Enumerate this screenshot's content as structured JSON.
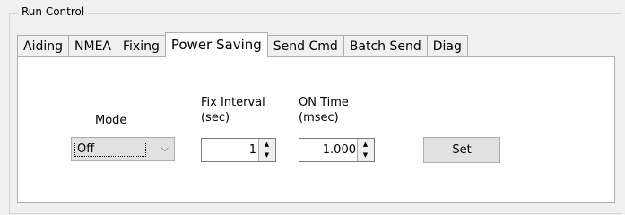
{
  "group": {
    "title": "Run Control"
  },
  "tabs": [
    {
      "label": "Aiding"
    },
    {
      "label": "NMEA"
    },
    {
      "label": "Fixing"
    },
    {
      "label": "Power Saving",
      "active": true
    },
    {
      "label": "Send Cmd"
    },
    {
      "label": "Batch Send"
    },
    {
      "label": "Diag"
    }
  ],
  "power_saving": {
    "mode_label": "Mode",
    "mode_value": "Off",
    "fix_interval_label_line1": "Fix Interval",
    "fix_interval_label_line2": "(sec)",
    "fix_interval_value": "1",
    "on_time_label_line1": "ON Time",
    "on_time_label_line2": "(msec)",
    "on_time_value": "1.000",
    "set_label": "Set"
  },
  "icons": {
    "combo_arrow": "chevron-down-icon",
    "spin_up": "triangle-up-icon",
    "spin_down": "triangle-down-icon"
  }
}
